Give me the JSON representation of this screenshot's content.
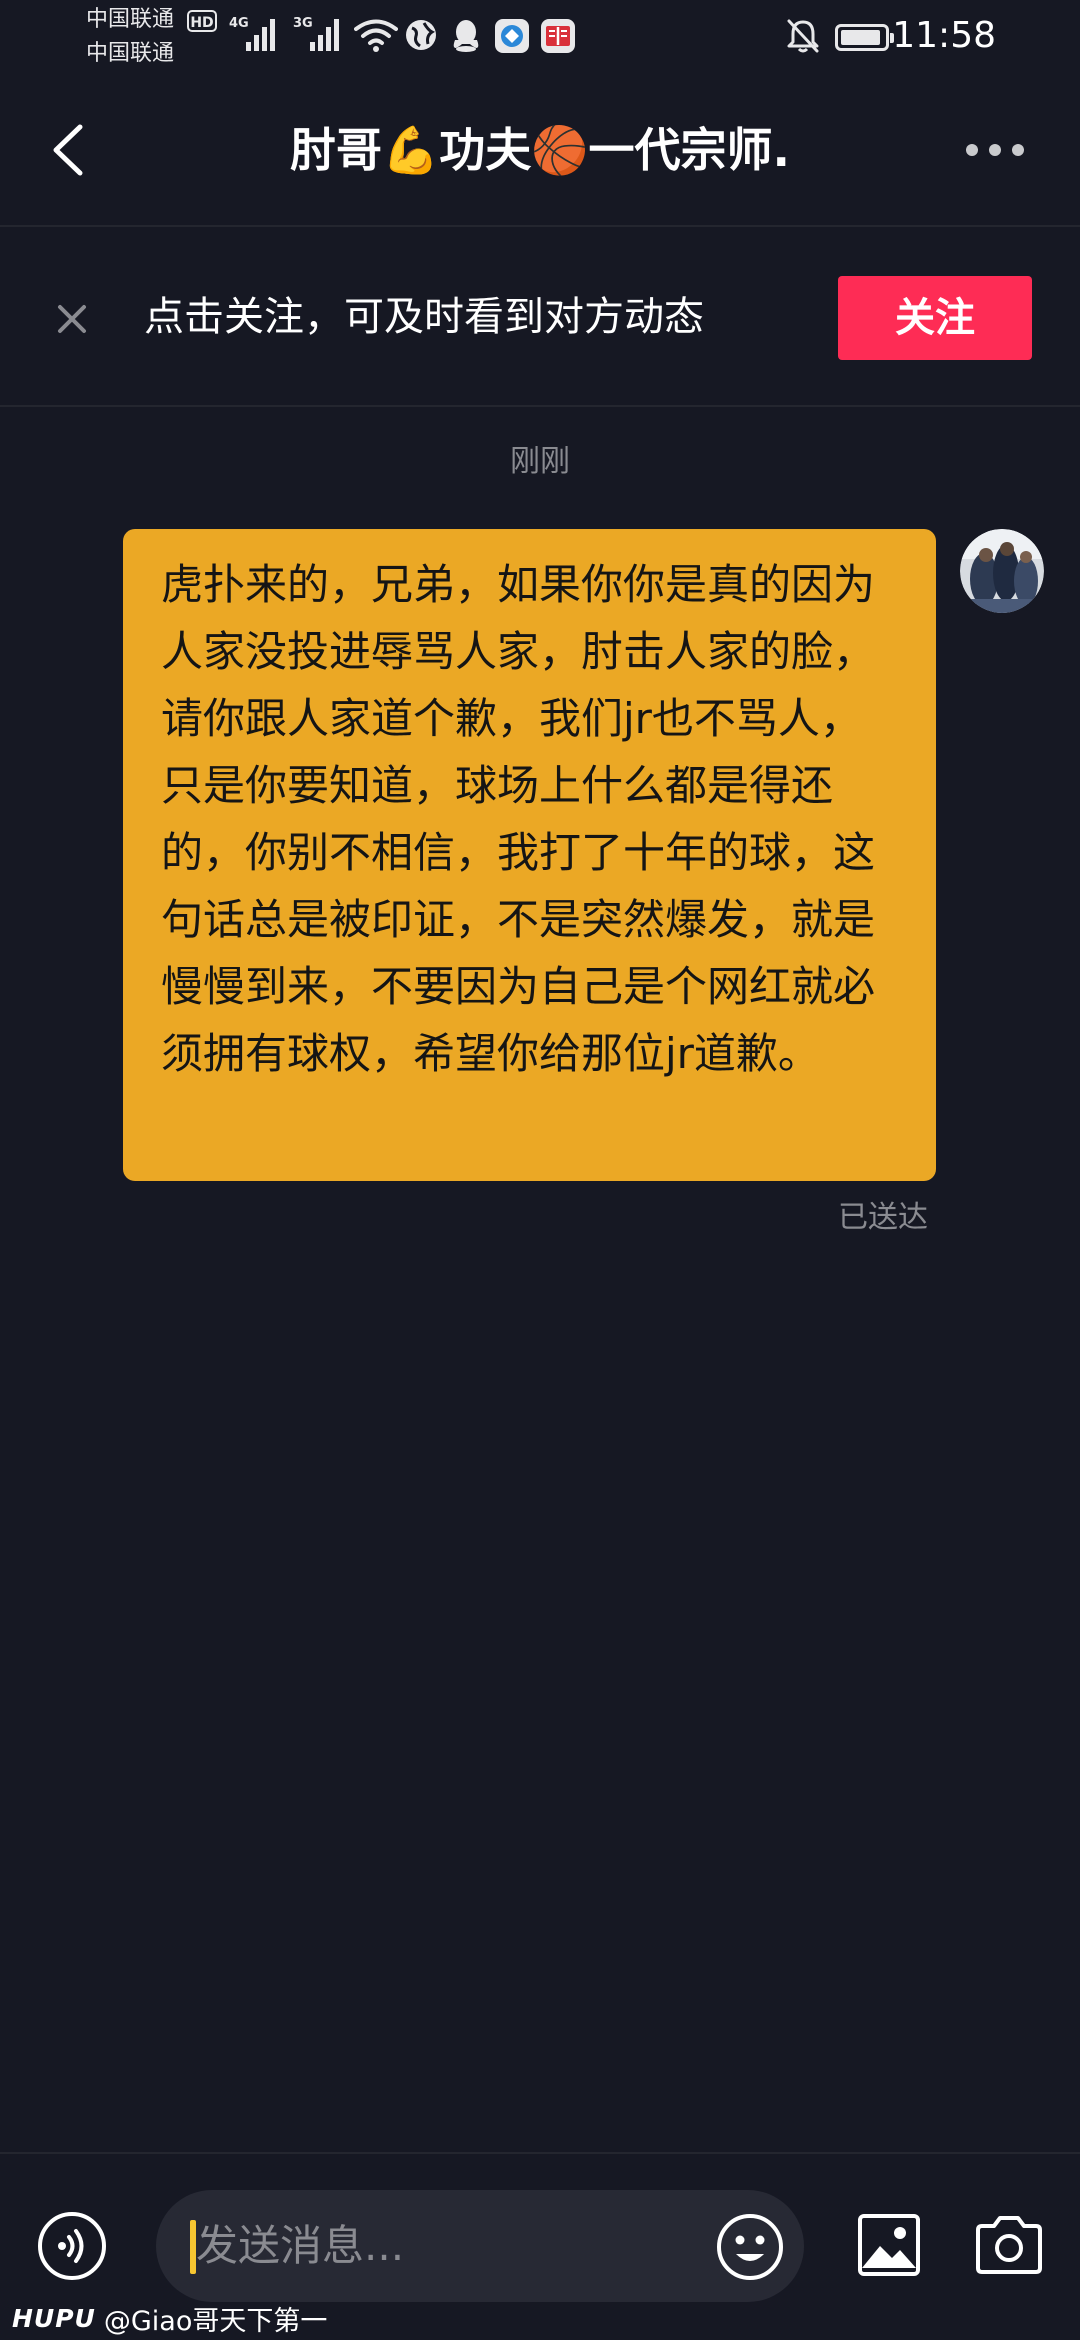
{
  "status_bar": {
    "carrier_1": "中国联通",
    "carrier_2": "中国联通",
    "hd_badge": "HD",
    "network_1": "4G",
    "network_2": "3G",
    "time": "11:58",
    "icons": [
      "signal-icon",
      "wifi-icon",
      "globe-icon",
      "qq-icon",
      "app-icon",
      "book-icon",
      "mute-bell-icon",
      "battery-icon"
    ]
  },
  "header": {
    "title": "肘哥💪功夫🏀一代宗师.",
    "back_icon": "chevron-left-icon",
    "more_icon": "more-dots-icon"
  },
  "follow_bar": {
    "prompt": "点击关注，可及时看到对方动态",
    "button_label": "关注",
    "dismiss_icon": "close-icon"
  },
  "messages": {
    "timestamp": "刚刚",
    "items": [
      {
        "sender": "self",
        "text": "虎扑来的，兄弟，如果你你是真的因为人家没投进辱骂人家，肘击人家的脸，请你跟人家道个歉，我们jr也不骂人，只是你要知道，球场上什么都是得还的，你别不相信，我打了十年的球，这句话总是被印证，不是突然爆发，就是慢慢到来，不要因为自己是个网红就必须拥有球权，希望你给那位jr道歉。",
        "status": "已送达"
      }
    ]
  },
  "input_bar": {
    "placeholder": "发送消息...",
    "voice_icon": "voice-icon",
    "emoji_icon": "emoji-icon",
    "image_icon": "image-icon",
    "camera_icon": "camera-icon"
  },
  "watermark": {
    "brand": "HUPU",
    "handle": "@Giao哥天下第一"
  },
  "colors": {
    "background": "#161823",
    "accent": "#fe2c55",
    "bubble": "#eba825",
    "muted_text": "#8a8b91",
    "input_bg": "#272934",
    "caret": "#f7c631"
  }
}
